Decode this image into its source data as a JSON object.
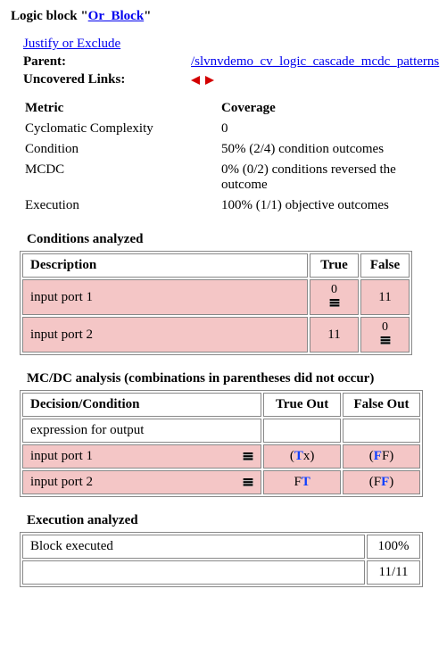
{
  "title_prefix": "Logic block \"",
  "block_name": "Or_Block",
  "title_suffix": "\"",
  "justify_link": "Justify or Exclude",
  "parent_label": "Parent:",
  "parent_link": "/slvnvdemo_cv_logic_cascade_mcdc_patterns",
  "uncovered_label": "Uncovered Links:",
  "metrics": {
    "metric_header": "Metric",
    "coverage_header": "Coverage",
    "rows": [
      {
        "label": "Cyclomatic Complexity",
        "value": "0"
      },
      {
        "label": "Condition",
        "value": "50% (2/4) condition outcomes"
      },
      {
        "label": "MCDC",
        "value": "0% (0/2) conditions reversed the outcome"
      },
      {
        "label": "Execution",
        "value": "100% (1/1) objective outcomes"
      }
    ]
  },
  "conditions": {
    "title": "Conditions analyzed",
    "headers": {
      "desc": "Description",
      "true": "True",
      "false": "False"
    },
    "rows": [
      {
        "desc": "input port 1",
        "true_val": "0",
        "true_icon": true,
        "false_val": "11",
        "false_icon": false
      },
      {
        "desc": "input port 2",
        "true_val": "11",
        "true_icon": false,
        "false_val": "0",
        "false_icon": true
      }
    ]
  },
  "mcdc": {
    "title": "MC/DC analysis (combinations in parentheses did not occur)",
    "headers": {
      "dc": "Decision/Condition",
      "tout": "True Out",
      "fout": "False Out"
    },
    "expr_row": "expression for output",
    "rows": [
      {
        "label": "input port 1",
        "tout_pre": "(",
        "tout_hl": "T",
        "tout_post": "x)",
        "fout_pre": "(",
        "fout_hl": "F",
        "fout_post": "F)"
      },
      {
        "label": "input port 2",
        "tout_pre": "F",
        "tout_hl": "T",
        "tout_post": "",
        "fout_pre": "(F",
        "fout_hl": "F",
        "fout_post": ")"
      }
    ]
  },
  "execution": {
    "title": "Execution analyzed",
    "rows": [
      {
        "label": "Block executed",
        "value": "100%"
      },
      {
        "label": "",
        "value": "11/11"
      }
    ]
  }
}
